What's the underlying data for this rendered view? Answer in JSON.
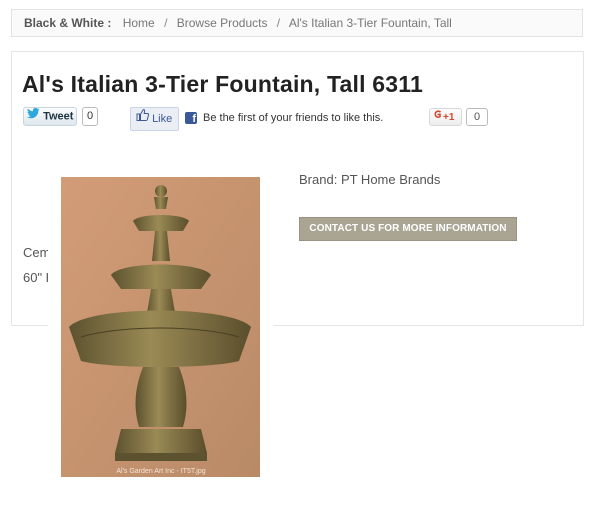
{
  "breadcrumb": {
    "title": "Black & White :",
    "items": [
      "Home",
      "Browse Products",
      "Al's Italian 3-Tier Fountain, Tall"
    ],
    "separator": "/"
  },
  "product": {
    "title": "Al's Italian 3-Tier Fountain, Tall 6311",
    "brand_label": "Brand:",
    "brand_value": "PT Home Brands",
    "contact_label": "CONTACT US FOR MORE INFORMATION",
    "description_line1": "Cem",
    "description_line2": "60\" H",
    "image_watermark": "Al's Garden Art Inc - IT5T.jpg"
  },
  "social": {
    "tweet_label": "Tweet",
    "tweet_count": "0",
    "like_label": "Like",
    "like_message": "Be the first of your friends to like this.",
    "fb_icon_glyph": "f",
    "gplus_label": "+1",
    "gplus_count": "0"
  },
  "colors": {
    "contact_button": "#aaa493",
    "facebook": "#3b5998",
    "twitter": "#2ca7e0",
    "gplus": "#d2472f",
    "image_background": "#c8956e",
    "fountain_stone": "#8b7a45"
  },
  "icons": {
    "twitter": "twitter-bird-icon",
    "like": "thumbs-up-icon",
    "facebook": "facebook-icon",
    "gplus": "google-plus-icon"
  }
}
